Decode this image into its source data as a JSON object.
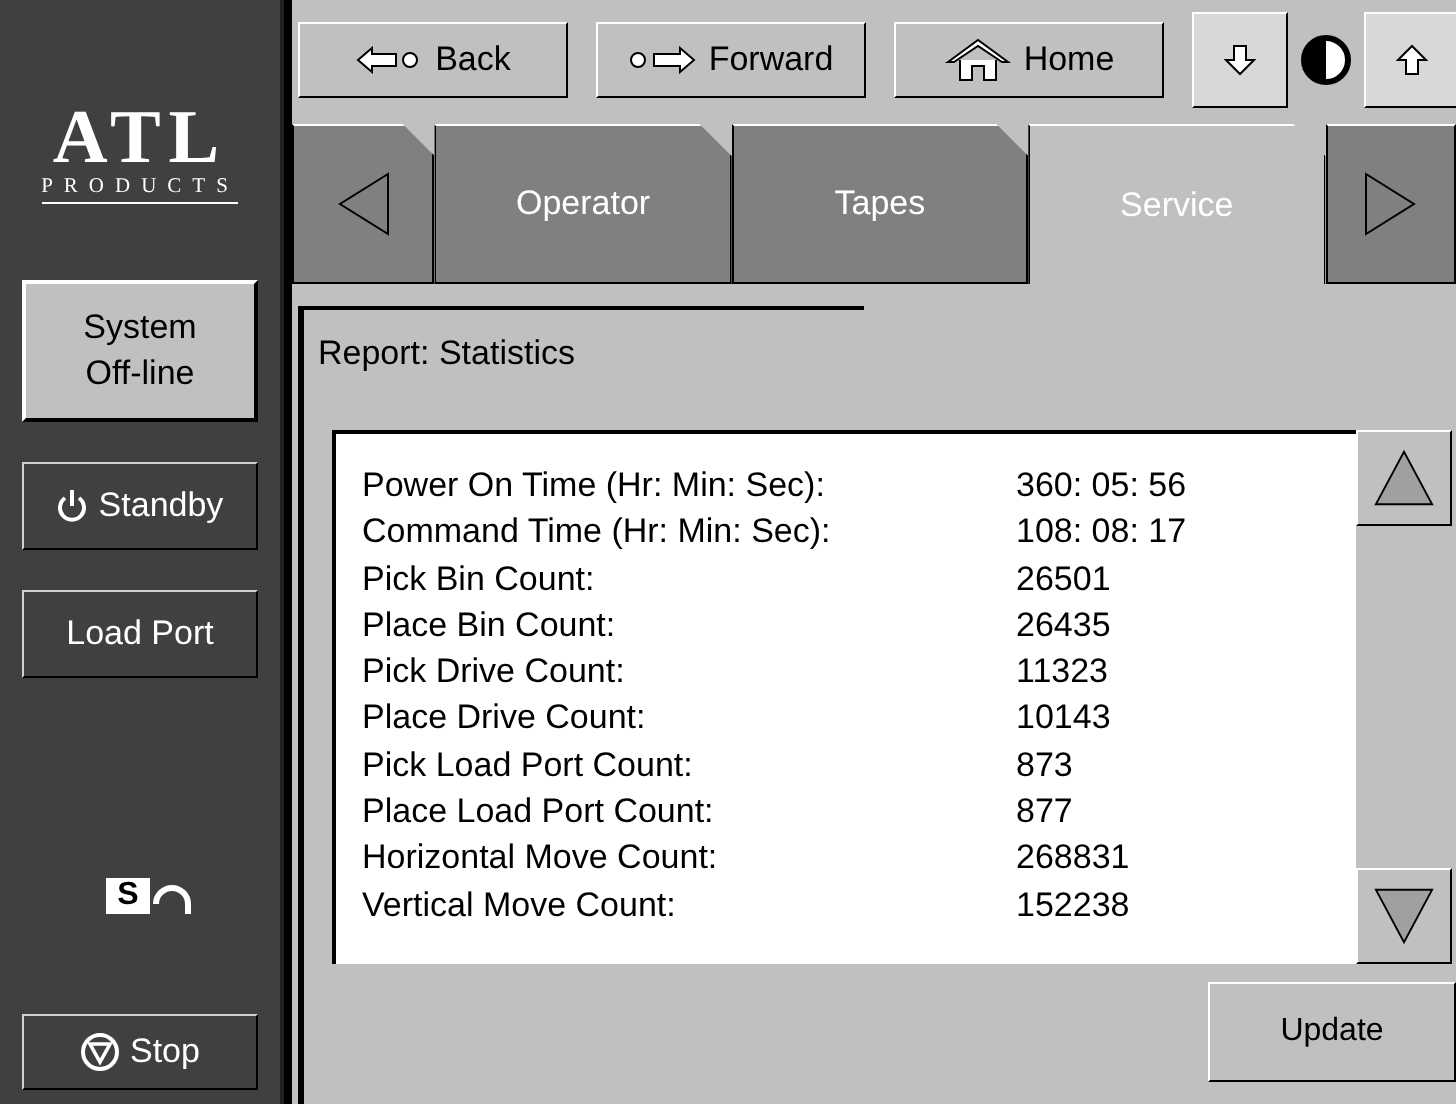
{
  "logo": {
    "name": "ATL",
    "subtitle": "PRODUCTS"
  },
  "sidebar": {
    "status_button": "System\nOff-line",
    "buttons": [
      {
        "kind": "standby",
        "label": "Standby"
      },
      {
        "kind": "plain",
        "label": "Load Port"
      }
    ],
    "lock": {
      "letter": "S",
      "locked": false
    },
    "stop_button": "Stop"
  },
  "toolbar": {
    "buttons": [
      {
        "kind": "back",
        "label": "Back"
      },
      {
        "kind": "forward",
        "label": "Forward"
      },
      {
        "kind": "home",
        "label": "Home"
      }
    ]
  },
  "tabs": [
    {
      "label": "Operator",
      "selected": false
    },
    {
      "label": "Tapes",
      "selected": false
    },
    {
      "label": "Service",
      "selected": true
    }
  ],
  "report": {
    "title": "Report: Statistics",
    "rows": [
      {
        "label": "Power On Time (Hr: Min: Sec):",
        "value": "360: 05: 56"
      },
      {
        "label": "Command Time (Hr: Min: Sec):",
        "value": "108: 08: 17"
      },
      {
        "label": "Pick Bin Count:",
        "value": "26501"
      },
      {
        "label": "Place Bin Count:",
        "value": "26435"
      },
      {
        "label": "Pick Drive Count:",
        "value": "11323"
      },
      {
        "label": "Place Drive Count:",
        "value": "10143"
      },
      {
        "label": "Pick Load Port Count:",
        "value": "873"
      },
      {
        "label": "Place Load Port Count:",
        "value": "877"
      },
      {
        "label": "Horizontal Move Count:",
        "value": "268831"
      },
      {
        "label": "Vertical Move Count:",
        "value": "152238"
      }
    ],
    "update_button": "Update"
  }
}
